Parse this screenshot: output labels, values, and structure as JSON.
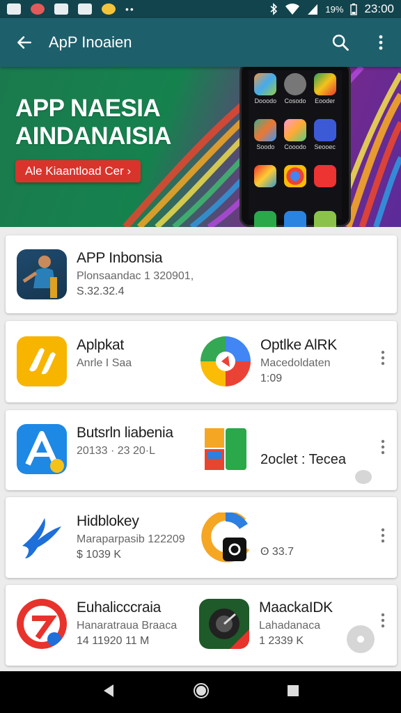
{
  "status_bar": {
    "battery": "19%",
    "time": "23:00",
    "more": "••"
  },
  "app_bar": {
    "title": "ApP Inoaien"
  },
  "banner": {
    "heading_line1": "APP NAESIA",
    "heading_line2": "AINDANAISIA",
    "button_label": "Ale Kiaantload Cer ›",
    "phone_apps": [
      "Dooodo",
      "Cosodo",
      "Eooder",
      "Soodo",
      "Cooodo",
      "Seooec",
      "",
      "",
      "",
      "",
      "",
      ""
    ]
  },
  "featured": {
    "name": "APP Inbonsia",
    "subtitle": "Plonsaandac 1 320901,",
    "meta": "S.32.32.4"
  },
  "rows": [
    {
      "left": {
        "name": "Aplpkat",
        "subtitle": "Anrle I Saa",
        "meta": ""
      },
      "right": {
        "name": "Optlke AlRK",
        "subtitle": "Macedoldaten",
        "meta": "1:09"
      }
    },
    {
      "left": {
        "name": "Butsrln liabenia",
        "subtitle": "20133 · 23 20·L",
        "meta": ""
      },
      "right": {
        "name": "",
        "subtitle": "",
        "meta": "2oclet : Tecea"
      }
    },
    {
      "left": {
        "name": "Hidblokey",
        "subtitle": "Maraparpasib 122209",
        "meta": "$ 1039 K"
      },
      "right": {
        "name": "",
        "subtitle": "",
        "meta": "ʘ 33.7"
      }
    },
    {
      "left": {
        "name": "Euhalicccraia",
        "subtitle": "Hanaratraua Braaca",
        "meta": "14 11920 11 M"
      },
      "right": {
        "name": "MaackaIDK",
        "subtitle": "Lahadanaca",
        "meta": "1 2339 K"
      }
    }
  ],
  "colors": {
    "status_bar": "#12444d",
    "app_bar": "#1e5f6c",
    "banner_green": "#15824e",
    "banner_purple": "#5a2b9a",
    "banner_button": "#d9342b"
  }
}
